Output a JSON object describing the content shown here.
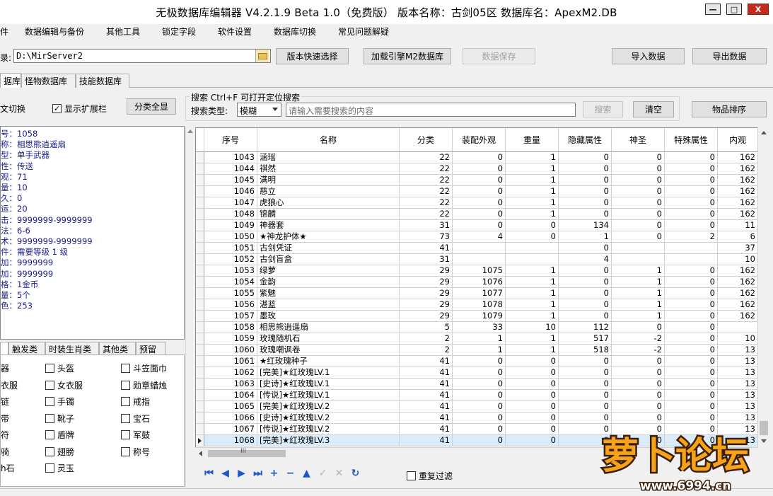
{
  "window": {
    "title": "无极数据库编辑器 V4.2.1.9   Beta 1.0（免费版）   版本名称：古剑05区    数据库名：ApexM2.DB",
    "min_glyph": "—",
    "max_glyph": "□",
    "close_glyph": "X"
  },
  "menu": [
    "件",
    "数据编辑与备份",
    "其他工具",
    "锁定字段",
    "软件设置",
    "数据库切换",
    "常见问题解疑"
  ],
  "toolbar": {
    "path_label": "录:",
    "path_value": "D:\\MirServer2",
    "version_select": "版本快速选择",
    "load_db": "加载引擎M2数据库",
    "save_data": "数据保存",
    "import_data": "导入数据",
    "export_data": "导出数据"
  },
  "tabs": [
    "据库",
    "怪物数据库",
    "技能数据库"
  ],
  "options": {
    "lang_switch": "文切换",
    "show_ext": "显示扩展栏",
    "show_ext_checked": "✓",
    "category_all": "分类全显"
  },
  "search": {
    "group_title": "搜索  Ctrl+F 可打开定位搜索",
    "type_label": "搜索类型:",
    "type_value": "模糊",
    "placeholder": "请输入需要搜索的内容",
    "search_button": "搜索",
    "clear_button": "清空",
    "sort_button": "物品排序"
  },
  "item_info": [
    "号：1058",
    "称：相思熊逍遥扇",
    "型：单手武器",
    "性：传送",
    "观：71",
    "量：10",
    "久：0",
    "运：20",
    "击：9999999-9999999",
    "法：6-6",
    "术：9999999-9999999",
    "件：需要等级 1 级",
    "加：9999999",
    "加：9999999",
    "格：1金币",
    "量：5个",
    "色：253"
  ],
  "category_tabs": [
    "",
    "触发类",
    "时装生肖类",
    "其他类",
    "预留"
  ],
  "categories": [
    [
      "器",
      "头盔",
      "斗笠面巾"
    ],
    [
      "衣服",
      "女衣服",
      "勋章蜡烛"
    ],
    [
      "链",
      "手镯",
      "戒指"
    ],
    [
      "带",
      "靴子",
      "宝石"
    ],
    [
      "符",
      "盾牌",
      "军鼓"
    ],
    [
      "骑",
      "翅膀",
      "称号"
    ],
    [
      "h石",
      "灵玉",
      ""
    ]
  ],
  "table": {
    "columns": [
      "序号",
      "名称",
      "分类",
      "装配外观",
      "重量",
      "隐藏属性",
      "神圣",
      "特殊属性",
      "内观"
    ],
    "rows": [
      [
        "1043",
        "涵瑶",
        "22",
        "0",
        "1",
        "0",
        "0",
        "0",
        "162"
      ],
      [
        "1044",
        "祺然",
        "22",
        "0",
        "1",
        "0",
        "0",
        "0",
        "162"
      ],
      [
        "1045",
        "满明",
        "22",
        "0",
        "1",
        "0",
        "0",
        "0",
        "162"
      ],
      [
        "1046",
        "慈立",
        "22",
        "0",
        "1",
        "0",
        "0",
        "0",
        "162"
      ],
      [
        "1047",
        "虎狼心",
        "22",
        "0",
        "1",
        "0",
        "0",
        "0",
        "162"
      ],
      [
        "1048",
        "锦麟",
        "22",
        "0",
        "1",
        "0",
        "0",
        "0",
        "162"
      ],
      [
        "1049",
        "神器套",
        "31",
        "0",
        "0",
        "134",
        "0",
        "0",
        "11"
      ],
      [
        "1050",
        "★神龙护体★",
        "73",
        "4",
        "0",
        "1",
        "0",
        "2",
        "6"
      ],
      [
        "1051",
        "古剑凭证",
        "41",
        "",
        "",
        "0",
        "",
        "",
        "37"
      ],
      [
        "1052",
        "古剑盲盒",
        "31",
        "",
        "",
        "4",
        "",
        "",
        "10"
      ],
      [
        "1053",
        "绿萝",
        "29",
        "1075",
        "1",
        "0",
        "1",
        "0",
        "162"
      ],
      [
        "1054",
        "金韵",
        "29",
        "1076",
        "1",
        "0",
        "1",
        "0",
        "162"
      ],
      [
        "1055",
        "紫魅",
        "29",
        "1077",
        "1",
        "0",
        "1",
        "0",
        "162"
      ],
      [
        "1056",
        "湛蓝",
        "29",
        "1078",
        "1",
        "0",
        "1",
        "0",
        "162"
      ],
      [
        "1057",
        "墨玫",
        "29",
        "1079",
        "1",
        "0",
        "1",
        "0",
        "162"
      ],
      [
        "1058",
        "相思熊逍遥扇",
        "5",
        "33",
        "10",
        "112",
        "0",
        "0",
        ""
      ],
      [
        "1059",
        "玫瑰随机石",
        "2",
        "1",
        "1",
        "517",
        "-2",
        "0",
        "10"
      ],
      [
        "1060",
        "玫瑰嘲讽卷",
        "2",
        "1",
        "1",
        "518",
        "-2",
        "0",
        "13"
      ],
      [
        "1061",
        "★红玫瑰种子",
        "41",
        "0",
        "0",
        "0",
        "0",
        "0",
        "13"
      ],
      [
        "1062",
        "[完美]★红玫瑰LV.1",
        "41",
        "0",
        "0",
        "0",
        "0",
        "0",
        "13"
      ],
      [
        "1063",
        "[史诗]★红玫瑰LV.1",
        "41",
        "0",
        "0",
        "0",
        "0",
        "0",
        "13"
      ],
      [
        "1064",
        "[传说]★红玫瑰LV.1",
        "41",
        "0",
        "0",
        "0",
        "0",
        "0",
        "13"
      ],
      [
        "1065",
        "[完美]★红玫瑰LV.2",
        "41",
        "0",
        "0",
        "0",
        "0",
        "0",
        "13"
      ],
      [
        "1066",
        "[史诗]★红玫瑰LV.2",
        "41",
        "0",
        "0",
        "0",
        "0",
        "0",
        "13"
      ],
      [
        "1067",
        "[传说]★红玫瑰LV.2",
        "41",
        "0",
        "0",
        "0",
        "0",
        "0",
        "13"
      ],
      [
        "1068",
        "[完美]★红玫瑰LV.3",
        "41",
        "0",
        "0",
        "0",
        "0",
        "0",
        "13"
      ]
    ]
  },
  "hscroll_thumb": "III",
  "navigator": [
    {
      "icon": "first-icon",
      "glyph": "⏮",
      "enabled": true
    },
    {
      "icon": "prior-icon",
      "glyph": "◀",
      "enabled": true
    },
    {
      "icon": "next-icon",
      "glyph": "▶",
      "enabled": true
    },
    {
      "icon": "last-icon",
      "glyph": "⏭",
      "enabled": true
    },
    {
      "icon": "insert-icon",
      "glyph": "+",
      "enabled": true
    },
    {
      "icon": "delete-icon",
      "glyph": "−",
      "enabled": true
    },
    {
      "icon": "edit-icon",
      "glyph": "▲",
      "enabled": true
    },
    {
      "icon": "post-icon",
      "glyph": "✓",
      "enabled": false
    },
    {
      "icon": "cancel-icon",
      "glyph": "✕",
      "enabled": false
    },
    {
      "icon": "refresh-icon",
      "glyph": "↻",
      "enabled": true
    }
  ],
  "dup_filter": "重复过滤",
  "watermark": {
    "brand": "萝卜论坛",
    "url": "www.6994.cn"
  }
}
